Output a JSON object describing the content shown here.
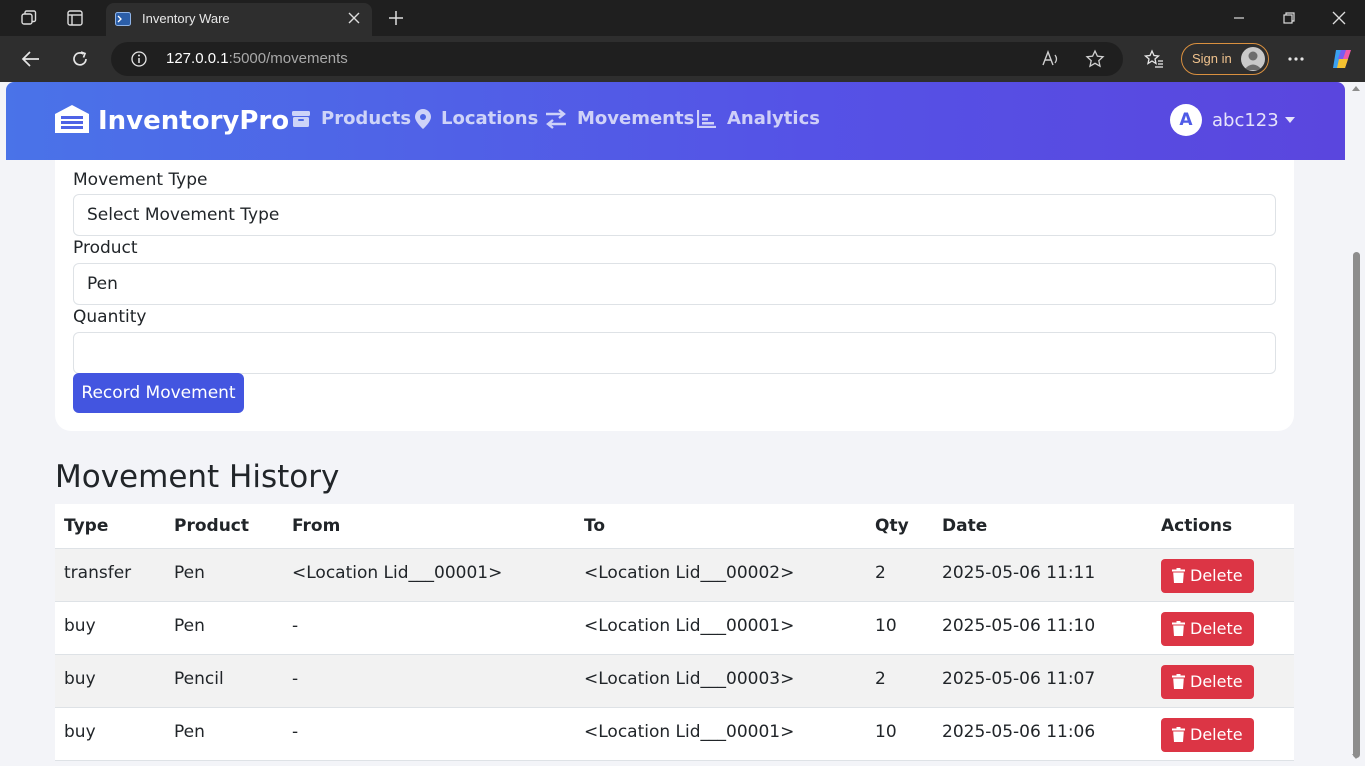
{
  "browser": {
    "tab_title": "Inventory Ware",
    "url_host": "127.0.0.1",
    "url_path": ":5000/movements",
    "signin_label": "Sign in"
  },
  "app": {
    "brand": "InventoryPro",
    "nav": [
      {
        "label": "Products",
        "icon": "box-icon"
      },
      {
        "label": "Locations",
        "icon": "map-pin-icon"
      },
      {
        "label": "Movements",
        "icon": "arrows-exchange-icon"
      },
      {
        "label": "Analytics",
        "icon": "chart-bar-icon"
      }
    ],
    "user": {
      "initial": "A",
      "name": "abc123"
    }
  },
  "form": {
    "movement_type_label": "Movement Type",
    "movement_type_value": "Select Movement Type",
    "product_label": "Product",
    "product_value": "Pen",
    "quantity_label": "Quantity",
    "quantity_value": "",
    "submit_label": "Record Movement"
  },
  "history": {
    "title": "Movement History",
    "columns": [
      "Type",
      "Product",
      "From",
      "To",
      "Qty",
      "Date",
      "Actions"
    ],
    "delete_label": "Delete",
    "rows": [
      {
        "type": "transfer",
        "product": "Pen",
        "from": "<Location Lid___00001>",
        "to": "<Location Lid___00002>",
        "qty": "2",
        "date": "2025-05-06 11:11"
      },
      {
        "type": "buy",
        "product": "Pen",
        "from": "-",
        "to": "<Location Lid___00001>",
        "qty": "10",
        "date": "2025-05-06 11:10"
      },
      {
        "type": "buy",
        "product": "Pencil",
        "from": "-",
        "to": "<Location Lid___00003>",
        "qty": "2",
        "date": "2025-05-06 11:07"
      },
      {
        "type": "buy",
        "product": "Pen",
        "from": "-",
        "to": "<Location Lid___00001>",
        "qty": "10",
        "date": "2025-05-06 11:06"
      }
    ]
  },
  "colors": {
    "primary": "#4355e0",
    "danger": "#dc3545",
    "navbar_start": "#4a73e8",
    "navbar_end": "#5a46de"
  }
}
